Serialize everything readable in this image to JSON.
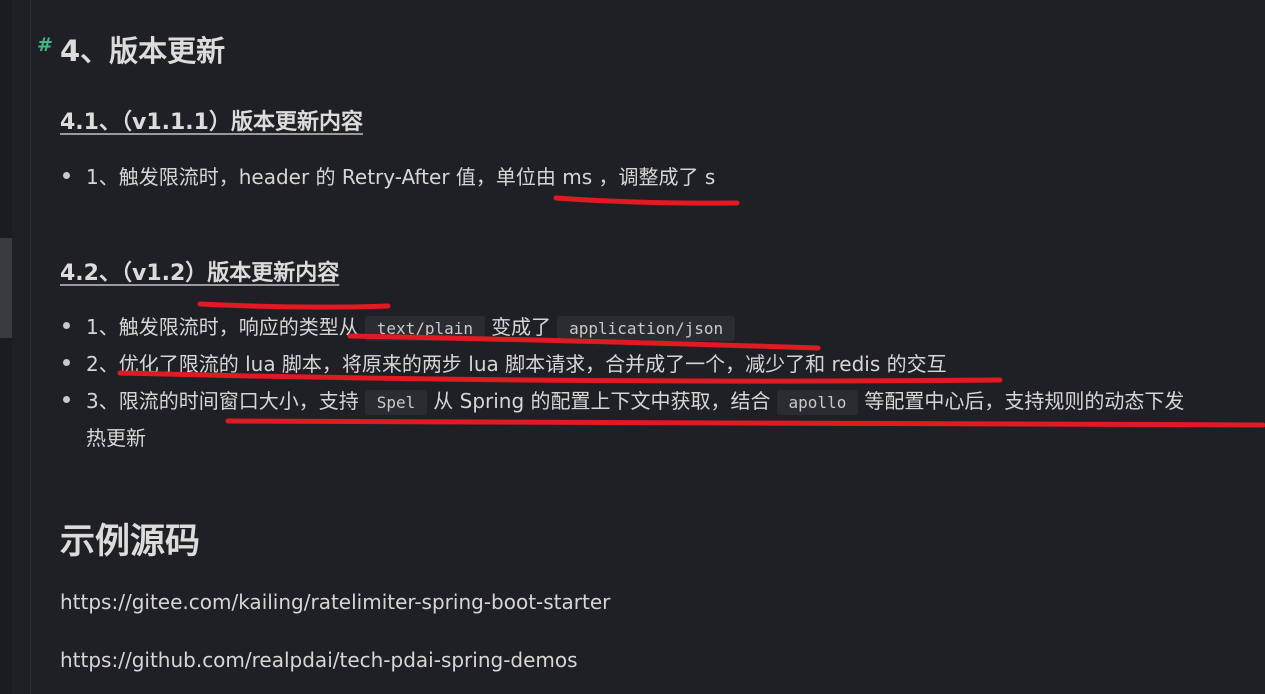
{
  "section": {
    "anchor": "#",
    "title": "4、版本更新"
  },
  "sub1": {
    "title": "4.1、（v1.1.1）版本更新内容",
    "items": [
      {
        "text": "1、触发限流时，header 的 Retry-After 值，单位由 ms ，调整成了 s"
      }
    ]
  },
  "sub2": {
    "title": "4.2、（v1.2）版本更新内容",
    "item1": {
      "before": "1、触发限流时，响应的类型从",
      "code1": "text/plain",
      "middle": "变成了",
      "code2": "application/json"
    },
    "item2": {
      "text": "2、优化了限流的 lua 脚本，将原来的两步 lua 脚本请求，合并成了一个，减少了和 redis 的交互"
    },
    "item3": {
      "before": "3、限流的时间窗口大小，支持",
      "code1": "Spel",
      "middle": "从 Spring 的配置上下文中获取，结合",
      "code2": "apollo",
      "after": "等配置中心后，支持规则的动态下发",
      "continuation": "热更新"
    }
  },
  "example": {
    "title": "示例源码",
    "links": [
      "https://gitee.com/kailing/ratelimiter-spring-boot-starter",
      "https://github.com/realpdai/tech-pdai-spring-demos"
    ]
  },
  "colors": {
    "background": "#1f2025",
    "anchor": "#42b983",
    "annotation": "#e01a22"
  }
}
